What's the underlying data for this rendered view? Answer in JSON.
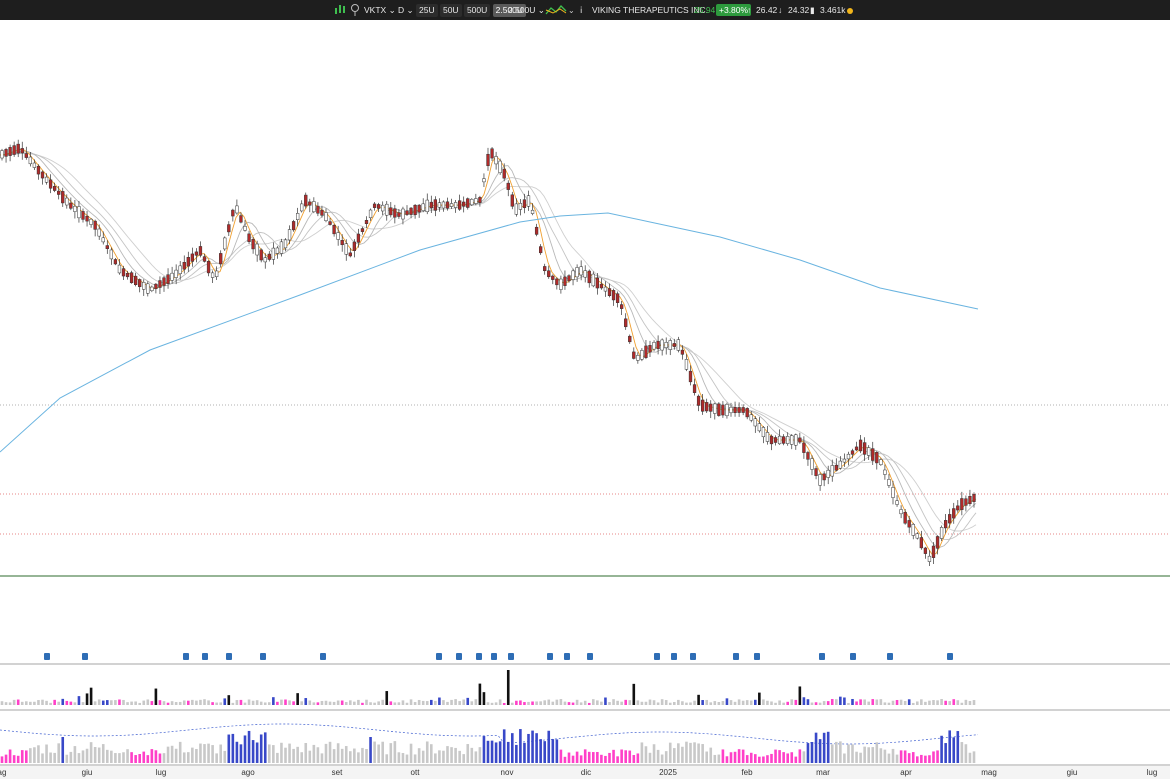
{
  "toolbar": {
    "symbol": "VKTX",
    "timeframe": "D",
    "size_options": [
      "25U",
      "50U",
      "500U",
      "2.500U"
    ],
    "selected_size": "2.500U",
    "size_dropdown": "2.500U",
    "company": "VIKING THERAPEUTICS INC.",
    "last_price": "25.94",
    "change_pct": "+3.80%",
    "high": "26.42",
    "low": "24.32",
    "volume": "3.461k"
  },
  "chart_data": {
    "type": "candlestick",
    "x_axis_labels": [
      "ag",
      "giu",
      "lug",
      "ago",
      "set",
      "ott",
      "nov",
      "dic",
      "2025",
      "feb",
      "mar",
      "apr",
      "mag",
      "giu",
      "lug"
    ],
    "colors": {
      "up_candle": "#ffffff",
      "down_candle": "#b02a2a",
      "ema_fast": "#f0a030",
      "ma_long": "#6ab4e0",
      "support_line": "#2d6b2d",
      "volume_dark": "#111111",
      "volume_blue": "#3848c8",
      "volume_pink": "#ff40c8",
      "volume_gray": "#c8c8c8"
    },
    "event_markers": 24
  }
}
